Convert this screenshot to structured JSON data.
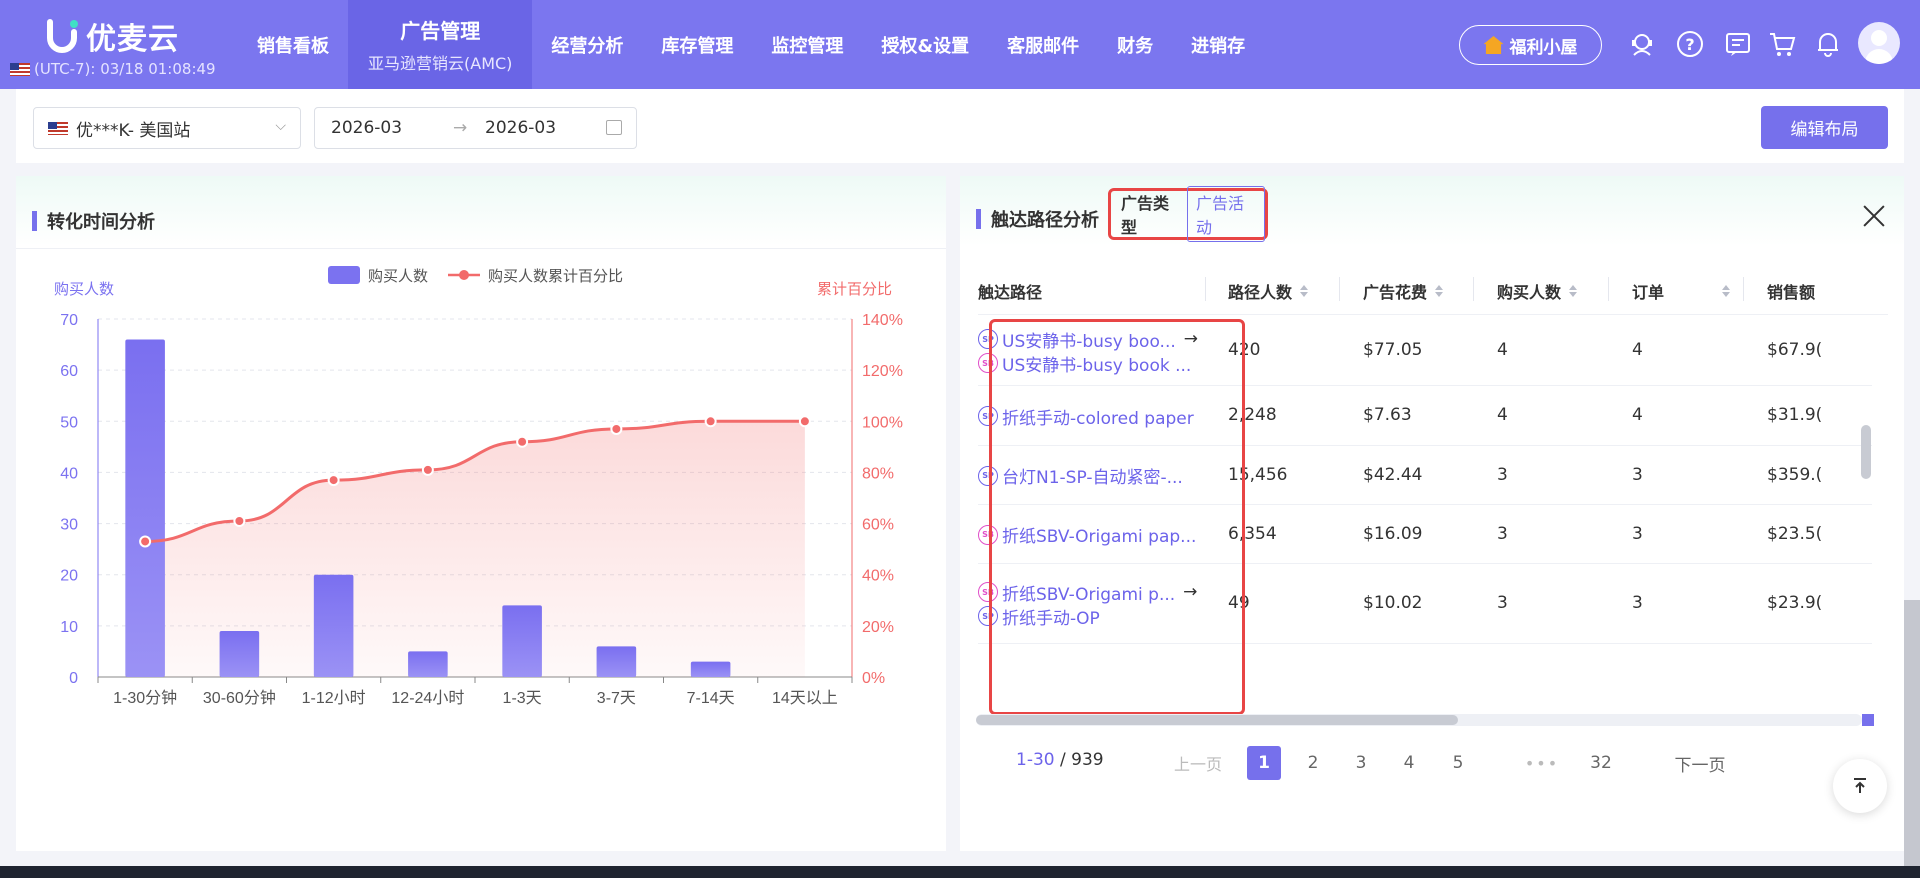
{
  "topbar": {
    "brand": "优麦云",
    "timezone": "(UTC-7): 03/18 01:08:49",
    "nav": [
      {
        "label": "销售看板"
      },
      {
        "label": "广告管理",
        "sub": "亚马逊营销云(AMC)",
        "active": true
      },
      {
        "label": "经营分析"
      },
      {
        "label": "库存管理"
      },
      {
        "label": "监控管理"
      },
      {
        "label": "授权&设置"
      },
      {
        "label": "客服邮件"
      },
      {
        "label": "财务"
      },
      {
        "label": "进销存"
      }
    ],
    "fuli_label": "福利小屋"
  },
  "filters": {
    "store": "优***K- 美国站",
    "date_start": "2026-03",
    "date_end": "2026-03",
    "date_sep": "→",
    "edit_layout": "编辑布局"
  },
  "left_panel": {
    "title": "转化时间分析"
  },
  "chart_data": {
    "type": "bar",
    "title": "",
    "categories": [
      "1-30分钟",
      "30-60分钟",
      "1-12小时",
      "12-24小时",
      "1-3天",
      "3-7天",
      "7-14天",
      "14天以上"
    ],
    "series": [
      {
        "name": "购买人数",
        "type": "bar",
        "axis": "left",
        "values": [
          66,
          9,
          20,
          5,
          14,
          6,
          3,
          0
        ],
        "color": "#7b72f0"
      },
      {
        "name": "购买人数累计百分比",
        "type": "line",
        "axis": "right",
        "values": [
          53,
          61,
          77,
          81,
          92,
          97,
          100,
          100
        ],
        "color": "#f26b6b"
      }
    ],
    "ylabel": "购买人数",
    "y2label": "累计百分比",
    "ylim": [
      0,
      70
    ],
    "yticks": [
      "0",
      "10",
      "20",
      "30",
      "40",
      "50",
      "60",
      "70"
    ],
    "y2lim": [
      0,
      140
    ],
    "y2ticks": [
      "0%",
      "20%",
      "40%",
      "60%",
      "80%",
      "100%",
      "120%",
      "140%"
    ],
    "legend": "top-center",
    "grid": true
  },
  "right_panel": {
    "title": "触达路径分析",
    "toggle": {
      "option1": "广告类型",
      "option2": "广告活动"
    },
    "columns": [
      "触达路径",
      "路径人数",
      "广告花费",
      "购买人数",
      "订单",
      "销售额"
    ],
    "rows": [
      {
        "path": [
          {
            "badge": "SP",
            "text": "US安静书-busy boo...",
            "arrow": "→"
          },
          {
            "badge": "SB",
            "text": "US安静书-busy book ..."
          }
        ],
        "people": "420",
        "spend": "$77.05",
        "buyers": "4",
        "orders": "4",
        "sales": "$67.9("
      },
      {
        "path": [
          {
            "badge": "SP",
            "text": "折纸手动-colored paper"
          }
        ],
        "people": "2,248",
        "spend": "$7.63",
        "buyers": "4",
        "orders": "4",
        "sales": "$31.9("
      },
      {
        "path": [
          {
            "badge": "SP",
            "text": "台灯N1-SP-自动紧密-..."
          }
        ],
        "people": "15,456",
        "spend": "$42.44",
        "buyers": "3",
        "orders": "3",
        "sales": "$359.("
      },
      {
        "path": [
          {
            "badge": "SB",
            "text": "折纸SBV-Origami pap..."
          }
        ],
        "people": "6,354",
        "spend": "$16.09",
        "buyers": "3",
        "orders": "3",
        "sales": "$23.5("
      },
      {
        "path": [
          {
            "badge": "SB",
            "text": "折纸SBV-Origami p...",
            "arrow": "→"
          },
          {
            "badge": "SP",
            "text": "折纸手动-OP"
          }
        ],
        "people": "49",
        "spend": "$10.02",
        "buyers": "3",
        "orders": "3",
        "sales": "$23.9("
      }
    ],
    "pagination": {
      "range": "1-30",
      "sep": " / ",
      "total": "939",
      "prev": "上一页",
      "next": "下一页",
      "pages": [
        "1",
        "2",
        "3",
        "4",
        "5"
      ],
      "ellipsis": "•••",
      "last": "32"
    }
  }
}
